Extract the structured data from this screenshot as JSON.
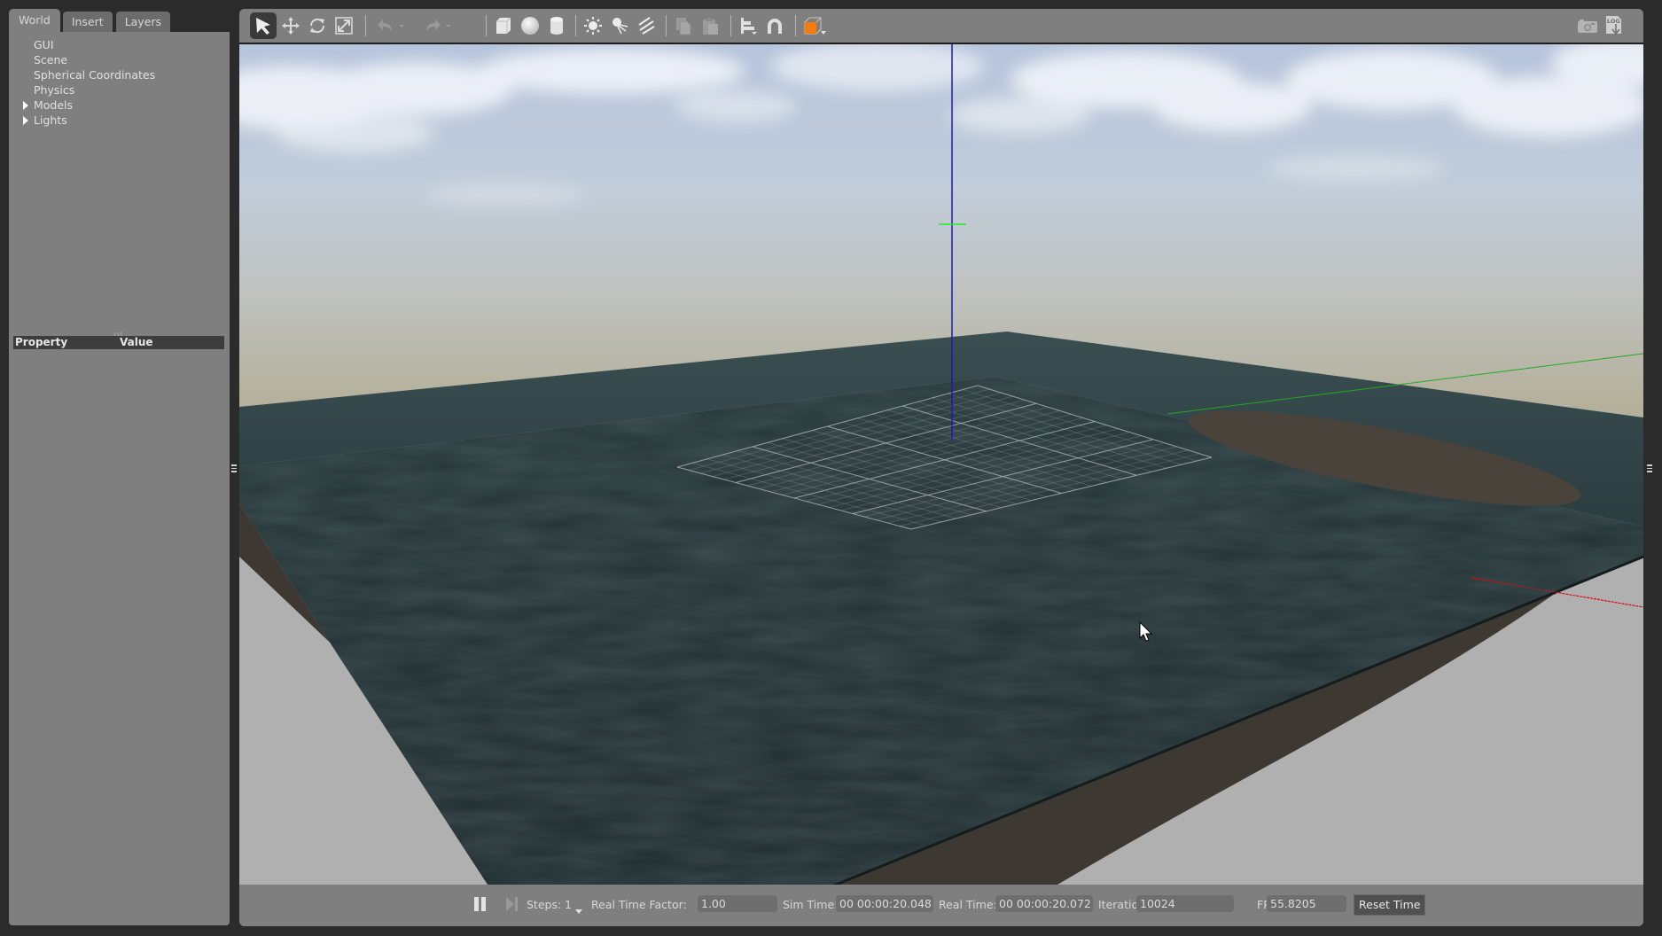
{
  "left_panel": {
    "tabs": [
      {
        "label": "World",
        "active": true
      },
      {
        "label": "Insert",
        "active": false
      },
      {
        "label": "Layers",
        "active": false
      }
    ],
    "tree": [
      {
        "label": "GUI",
        "expandable": false
      },
      {
        "label": "Scene",
        "expandable": false
      },
      {
        "label": "Spherical Coordinates",
        "expandable": false
      },
      {
        "label": "Physics",
        "expandable": false
      },
      {
        "label": "Models",
        "expandable": true
      },
      {
        "label": "Lights",
        "expandable": true
      }
    ],
    "property_table": {
      "columns": [
        "Property",
        "Value"
      ]
    }
  },
  "toolbar": {
    "tools": [
      {
        "icon": "select-arrow-icon",
        "active": true
      },
      {
        "icon": "translate-icon"
      },
      {
        "icon": "rotate-icon"
      },
      {
        "icon": "scale-icon"
      },
      {
        "icon": "undo-icon",
        "enabled": false
      },
      {
        "icon": "undo-dropdown-icon",
        "enabled": false
      },
      {
        "icon": "redo-icon",
        "enabled": false
      },
      {
        "icon": "redo-dropdown-icon",
        "enabled": false
      },
      {
        "icon": "box-shape-icon"
      },
      {
        "icon": "sphere-shape-icon"
      },
      {
        "icon": "cylinder-shape-icon"
      },
      {
        "icon": "point-light-icon"
      },
      {
        "icon": "spot-light-icon"
      },
      {
        "icon": "directional-light-icon"
      },
      {
        "icon": "copy-icon",
        "enabled": false
      },
      {
        "icon": "paste-icon",
        "enabled": false
      },
      {
        "icon": "align-icon"
      },
      {
        "icon": "snap-magnet-icon"
      },
      {
        "icon": "view-angle-icon"
      }
    ],
    "right_tools": [
      {
        "icon": "screenshot-camera-icon"
      },
      {
        "icon": "log-download-icon",
        "text": "LOG"
      }
    ]
  },
  "scene": {
    "colors": {
      "sky_top": "#b9c7dd",
      "horizon": "#b5b19e",
      "water_far": "#34484a",
      "water_near": "#1f2d2f",
      "ground_side": "#3e3833",
      "sandbar": "#4a423c",
      "background_gray": "#b0b0b0",
      "axis_x": "#d40000",
      "axis_y": "#00cc00",
      "axis_z": "#1a1ab8"
    }
  },
  "status_bar": {
    "pause_icon": "pause-icon",
    "step_icon": "step-forward-icon",
    "steps_label": "Steps:",
    "steps_value": "1",
    "rtf_label": "Real Time Factor:",
    "rtf_value": "1.00",
    "sim_time_label": "Sim Time:",
    "sim_time_value": "00 00:00:20.048",
    "real_time_label": "Real Time:",
    "real_time_value": "00 00:00:20.072",
    "iterations_label": "Iterations:",
    "iterations_value": "10024",
    "fps_label": "FPS:",
    "fps_value": "55.8205",
    "reset_label": "Reset Time"
  }
}
